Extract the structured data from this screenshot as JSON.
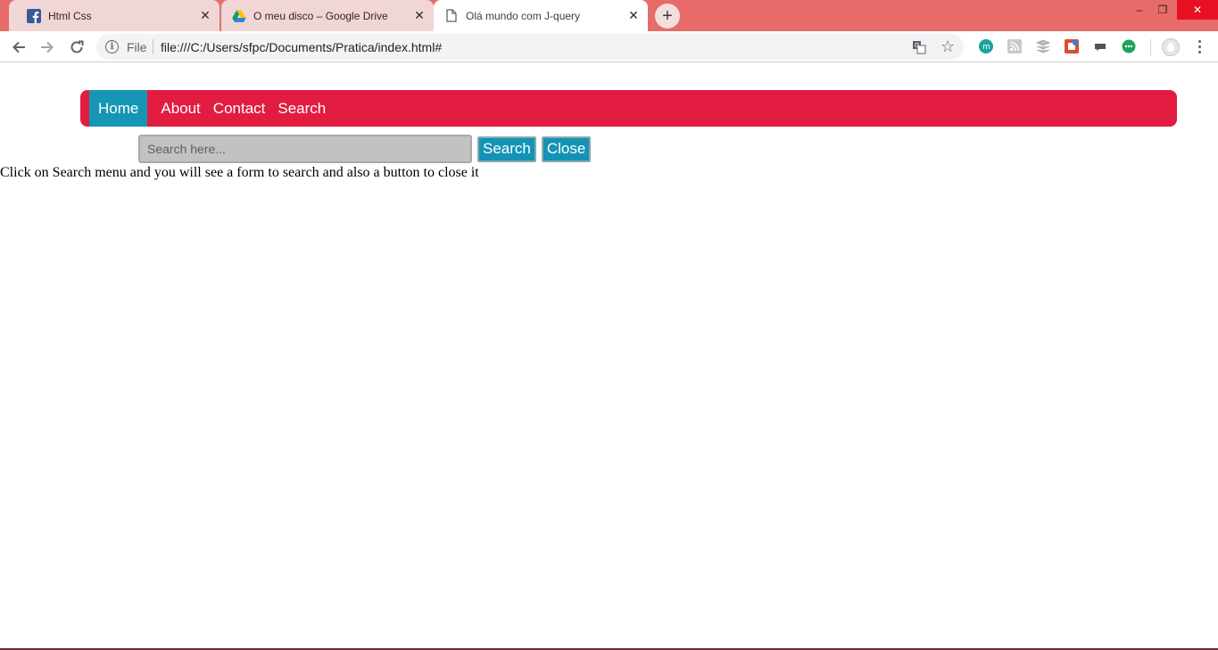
{
  "browser": {
    "tabs": [
      {
        "title": "Html Css",
        "icon": "facebook-icon",
        "active": false
      },
      {
        "title": "O meu disco – Google Drive",
        "icon": "google-drive-icon",
        "active": false
      },
      {
        "title": "Olá mundo com J-query",
        "icon": "document-icon",
        "active": true
      }
    ],
    "new_tab_symbol": "+",
    "close_symbol": "✕",
    "window_controls": {
      "minimize": "–",
      "restore": "❐",
      "close": "✕"
    },
    "omnibox": {
      "scheme_label": "File",
      "url": "file:///C:/Users/sfpc/Documents/Pratica/index.html#"
    },
    "accent_color": "#e76b69"
  },
  "page": {
    "nav": {
      "items": [
        "Home",
        "About",
        "Contact",
        "Search"
      ],
      "active": "Home",
      "bg_color": "#e21c41",
      "active_color": "#1696b5"
    },
    "search_form": {
      "placeholder": "Search here...",
      "search_label": "Search",
      "close_label": "Close"
    },
    "info_text": "Click on Search menu and you will see a form to search and also a button to close it"
  }
}
